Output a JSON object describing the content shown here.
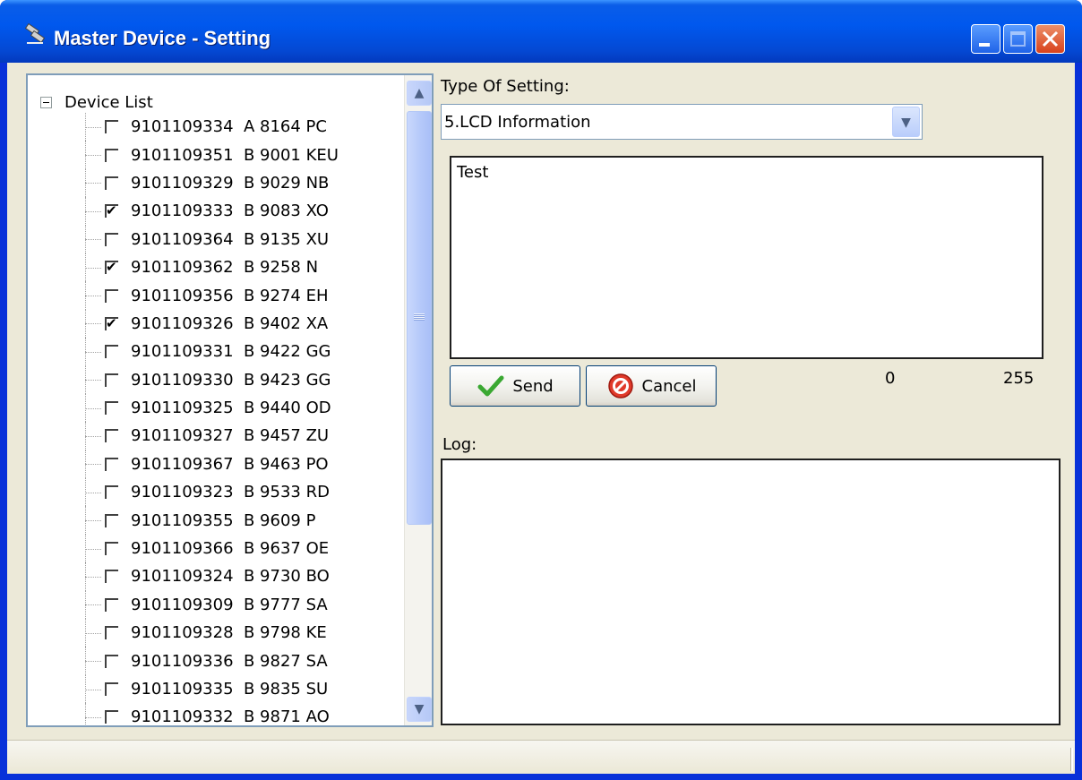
{
  "window": {
    "title": "Master Device - Setting"
  },
  "tree": {
    "root_label": "Device List",
    "items": [
      {
        "label": "9101109334  A 8164 PC",
        "checked": false
      },
      {
        "label": "9101109351  B 9001 KEU",
        "checked": false
      },
      {
        "label": "9101109329  B 9029 NB",
        "checked": false
      },
      {
        "label": "9101109333  B 9083 XO",
        "checked": true
      },
      {
        "label": "9101109364  B 9135 XU",
        "checked": false
      },
      {
        "label": "9101109362  B 9258 N",
        "checked": true
      },
      {
        "label": "9101109356  B 9274 EH",
        "checked": false
      },
      {
        "label": "9101109326  B 9402 XA",
        "checked": true
      },
      {
        "label": "9101109331  B 9422 GG",
        "checked": false
      },
      {
        "label": "9101109330  B 9423 GG",
        "checked": false
      },
      {
        "label": "9101109325  B 9440 OD",
        "checked": false
      },
      {
        "label": "9101109327  B 9457 ZU",
        "checked": false
      },
      {
        "label": "9101109367  B 9463 PO",
        "checked": false
      },
      {
        "label": "9101109323  B 9533 RD",
        "checked": false
      },
      {
        "label": "9101109355  B 9609 P",
        "checked": false
      },
      {
        "label": "9101109366  B 9637 OE",
        "checked": false
      },
      {
        "label": "9101109324  B 9730 BO",
        "checked": false
      },
      {
        "label": "9101109309  B 9777 SA",
        "checked": false
      },
      {
        "label": "9101109328  B 9798 KE",
        "checked": false
      },
      {
        "label": "9101109336  B 9827 SA",
        "checked": false
      },
      {
        "label": "9101109335  B 9835 SU",
        "checked": false
      },
      {
        "label": "9101109332  B 9871 AO",
        "checked": false
      }
    ]
  },
  "settings": {
    "type_label": "Type Of Setting:",
    "type_value": "5.LCD Information",
    "text_value": "Test",
    "count_min": "0",
    "count_max": "255",
    "send_label": "Send",
    "cancel_label": "Cancel",
    "log_label": "Log:"
  }
}
